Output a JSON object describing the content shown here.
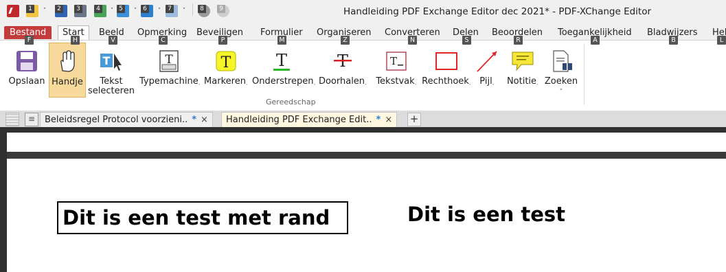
{
  "window": {
    "title": "Handleiding PDF Exchange Editor dec 2021* - PDF-XChange Editor"
  },
  "qat": {
    "buttons": [
      {
        "num": "1",
        "icon": "open-folder-icon"
      },
      {
        "num": "2",
        "icon": "save-icon"
      },
      {
        "num": "3",
        "icon": "print-icon"
      },
      {
        "num": "4",
        "icon": "new-document-icon"
      },
      {
        "num": "5",
        "icon": "comment-icon"
      },
      {
        "num": "6",
        "icon": "undo-icon"
      },
      {
        "num": "7",
        "icon": "redo-icon"
      },
      {
        "num": "8",
        "icon": "back-icon"
      },
      {
        "num": "9",
        "icon": "forward-icon"
      }
    ]
  },
  "menu": {
    "tabs": [
      {
        "label": "Bestand",
        "key": "F"
      },
      {
        "label": "Start",
        "key": "H"
      },
      {
        "label": "Beeld",
        "key": "V"
      },
      {
        "label": "Opmerking",
        "key": "C"
      },
      {
        "label": "Beveiligen",
        "key": "P"
      },
      {
        "label": "Formulier",
        "key": "M"
      },
      {
        "label": "Organiseren",
        "key": "Z"
      },
      {
        "label": "Converteren",
        "key": "N"
      },
      {
        "label": "Delen",
        "key": "S"
      },
      {
        "label": "Beoordelen",
        "key": "R"
      },
      {
        "label": "Toegankelijkheid",
        "key": "A"
      },
      {
        "label": "Bladwijzers",
        "key": "B"
      },
      {
        "label": "Hel",
        "key": "L"
      }
    ]
  },
  "ribbon": {
    "group_label": "Gereedschap",
    "buttons": [
      {
        "label": "Opslaan"
      },
      {
        "label": "Handje"
      },
      {
        "label": "Tekst",
        "label2": "selecteren"
      },
      {
        "label": "Typemachine"
      },
      {
        "label": "Markeren"
      },
      {
        "label": "Onderstrepen"
      },
      {
        "label": "Doorhalen"
      },
      {
        "label": "Tekstvak"
      },
      {
        "label": "Rechthoek"
      },
      {
        "label": "Pijl"
      },
      {
        "label": "Notitie"
      },
      {
        "label": "Zoeken"
      }
    ]
  },
  "doc_tabs": [
    {
      "label": "Beleidsregel Protocol voorzieni..",
      "modified": "*",
      "close": "×"
    },
    {
      "label": "Handleiding PDF Exchange Edit..",
      "modified": "*",
      "close": "×"
    }
  ],
  "add_tab": "+",
  "document": {
    "bordered_text": "Dit is een test met rand",
    "plain_text": "Dit is een test"
  },
  "colors": {
    "file_tab": "#c33b3b",
    "active_tab_bg": "#fff7df",
    "hand_active": "#f7d99b",
    "page_gap": "#303030"
  }
}
